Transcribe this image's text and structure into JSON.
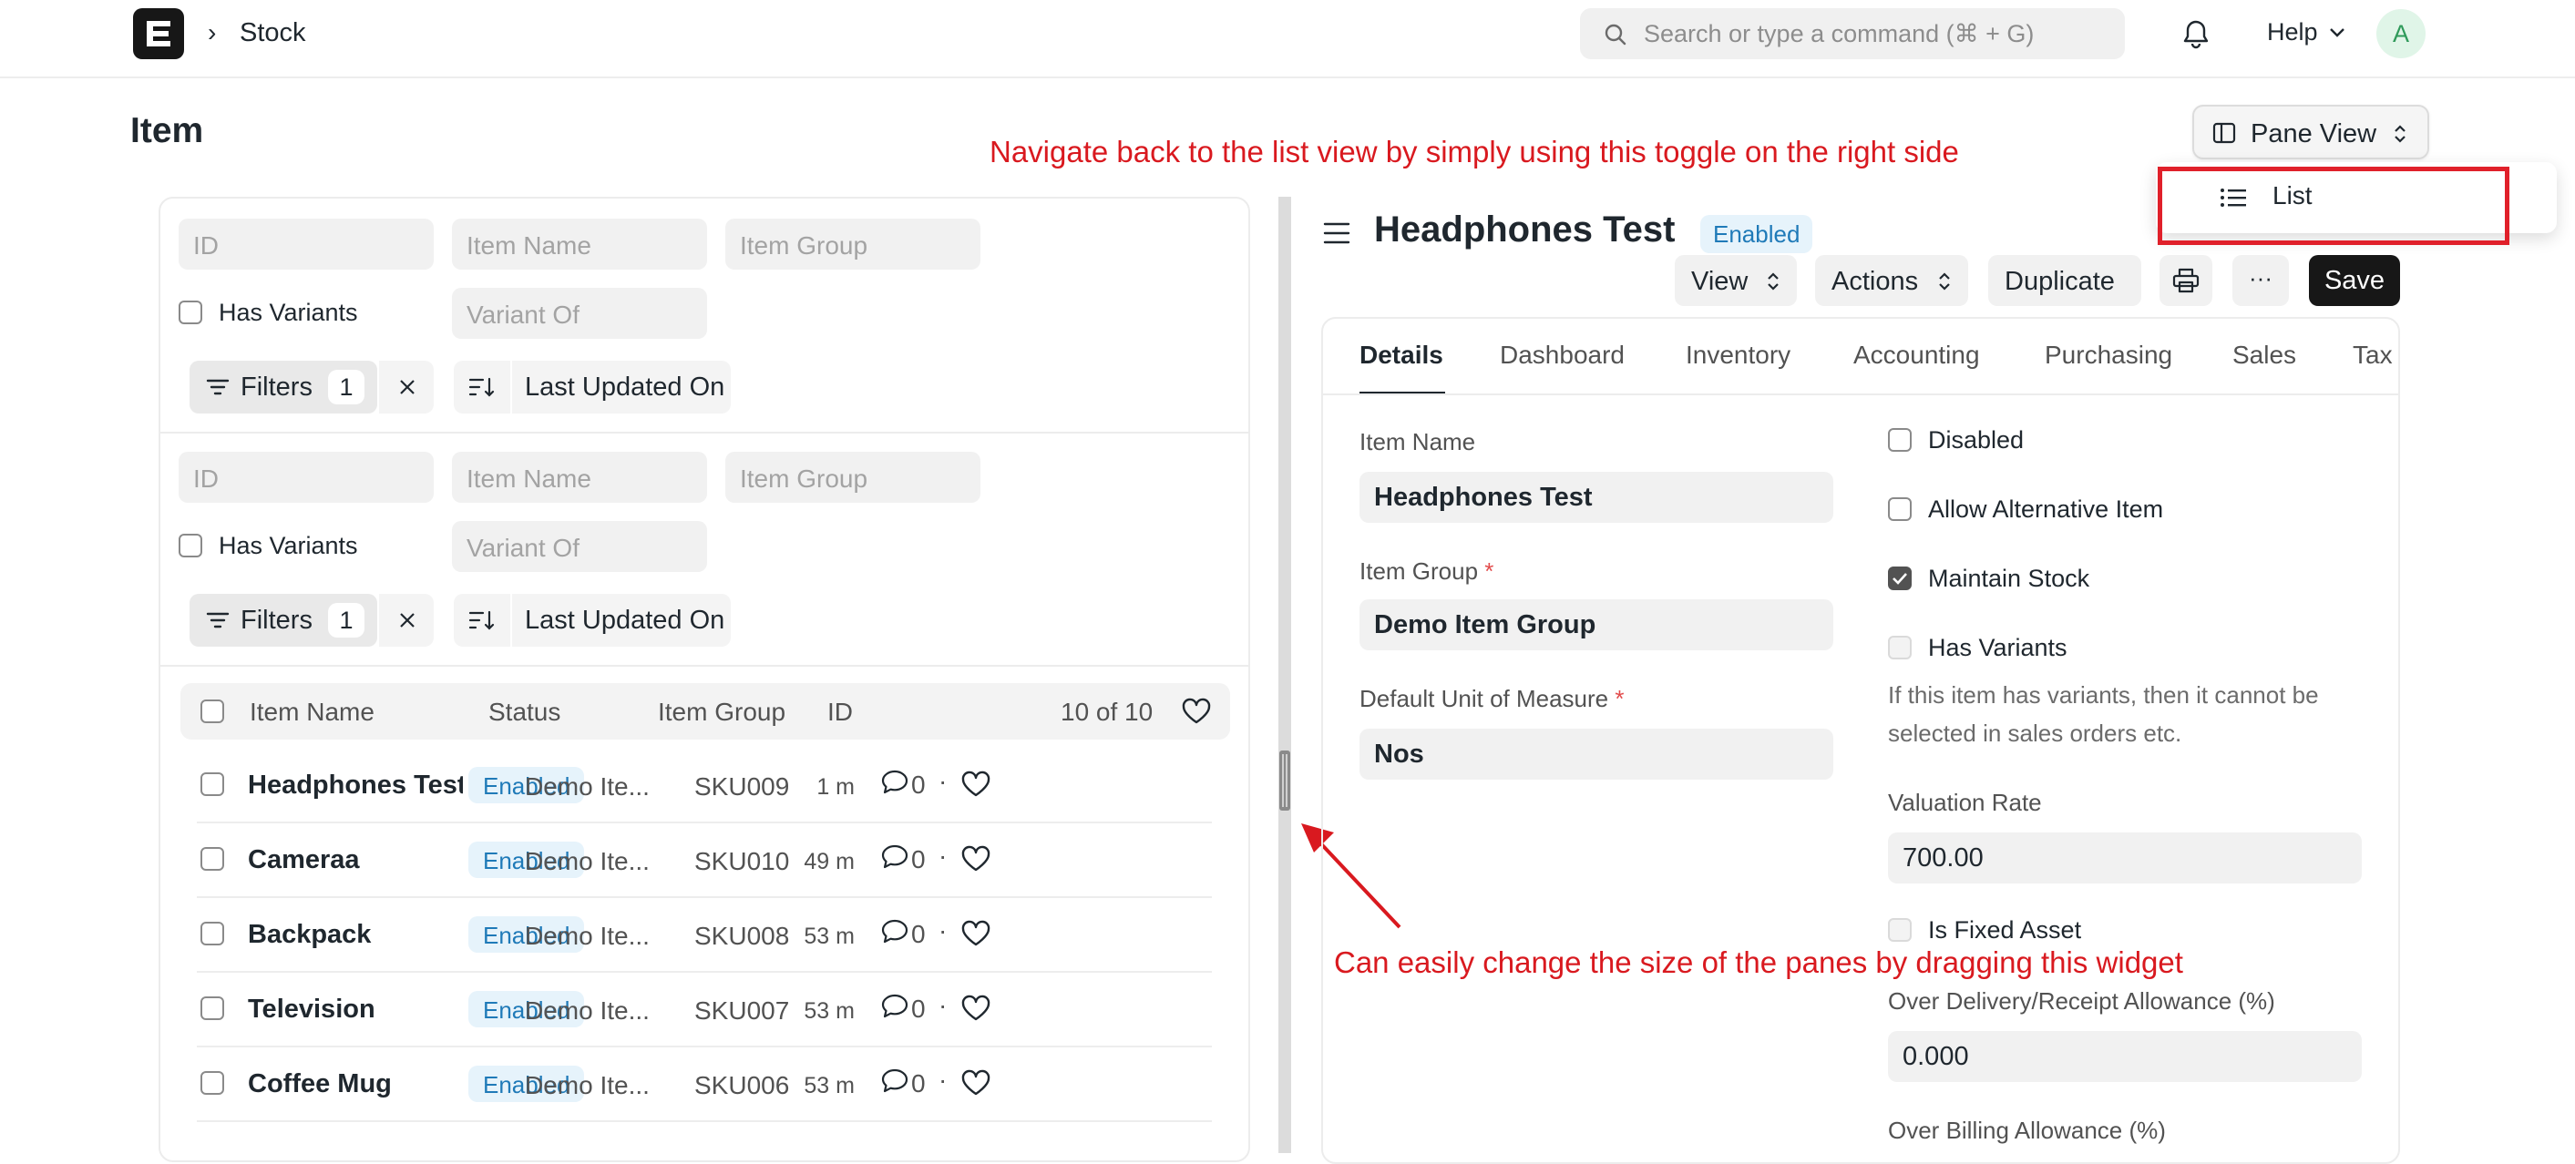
{
  "navbar": {
    "breadcrumb": "Stock",
    "search_placeholder": "Search or type a command (⌘ + G)",
    "help_label": "Help",
    "avatar_initial": "A"
  },
  "page": {
    "title": "Item",
    "pane_view_label": "Pane View",
    "dropdown_option": "List"
  },
  "annotations": {
    "toggle_note": "Navigate back to the list view by simply using this toggle on the right side",
    "resize_note": "Can easily change the size of the panes by dragging this widget"
  },
  "list_pane": {
    "filter_groups": [
      {
        "id_placeholder": "ID",
        "item_name_placeholder": "Item Name",
        "item_group_placeholder": "Item Group",
        "has_variants_label": "Has Variants",
        "variant_of_placeholder": "Variant Of",
        "filters_label": "Filters",
        "filters_count": "1",
        "sort_label": "Last Updated On"
      },
      {
        "id_placeholder": "ID",
        "item_name_placeholder": "Item Name",
        "item_group_placeholder": "Item Group",
        "has_variants_label": "Has Variants",
        "variant_of_placeholder": "Variant Of",
        "filters_label": "Filters",
        "filters_count": "1",
        "sort_label": "Last Updated On"
      }
    ],
    "columns": {
      "item_name": "Item Name",
      "status": "Status",
      "item_group": "Item Group",
      "id": "ID",
      "count": "10 of 10"
    },
    "rows": [
      {
        "name": "Headphones Test",
        "status": "Enabled",
        "group": "Demo Ite...",
        "id": "SKU009",
        "time": "1 m",
        "comments": "0"
      },
      {
        "name": "Cameraa",
        "status": "Enabled",
        "group": "Demo Ite...",
        "id": "SKU010",
        "time": "49 m",
        "comments": "0"
      },
      {
        "name": "Backpack",
        "status": "Enabled",
        "group": "Demo Ite...",
        "id": "SKU008",
        "time": "53 m",
        "comments": "0"
      },
      {
        "name": "Television",
        "status": "Enabled",
        "group": "Demo Ite...",
        "id": "SKU007",
        "time": "53 m",
        "comments": "0"
      },
      {
        "name": "Coffee Mug",
        "status": "Enabled",
        "group": "Demo Ite...",
        "id": "SKU006",
        "time": "53 m",
        "comments": "0"
      }
    ]
  },
  "doc": {
    "title": "Headphones Test",
    "status": "Enabled",
    "toolbar": {
      "view": "View",
      "actions": "Actions",
      "duplicate": "Duplicate",
      "more": "···",
      "save": "Save"
    },
    "tabs": [
      "Details",
      "Dashboard",
      "Inventory",
      "Accounting",
      "Purchasing",
      "Sales",
      "Tax"
    ],
    "fields": {
      "item_name_label": "Item Name",
      "item_name_value": "Headphones Test",
      "item_group_label": "Item Group",
      "item_group_value": "Demo Item Group",
      "uom_label": "Default Unit of Measure",
      "uom_value": "Nos",
      "required_mark": "*",
      "disabled_label": "Disabled",
      "allow_alt_label": "Allow Alternative Item",
      "maintain_stock_label": "Maintain Stock",
      "has_variants_label": "Has Variants",
      "has_variants_help": "If this item has variants, then it cannot be selected in sales orders etc.",
      "valuation_rate_label": "Valuation Rate",
      "valuation_rate_value": "700.00",
      "fixed_asset_label": "Is Fixed Asset",
      "over_delivery_label": "Over Delivery/Receipt Allowance (%)",
      "over_delivery_value": "0.000",
      "over_billing_label": "Over Billing Allowance (%)"
    },
    "checkbox_states": {
      "disabled": false,
      "allow_alternative_item": false,
      "maintain_stock": true
    }
  },
  "colors": {
    "annotation": "#d9191f",
    "badge_bg": "#e6f3fb",
    "badge_text": "#1f7ab8",
    "primary_button": "#171717"
  }
}
